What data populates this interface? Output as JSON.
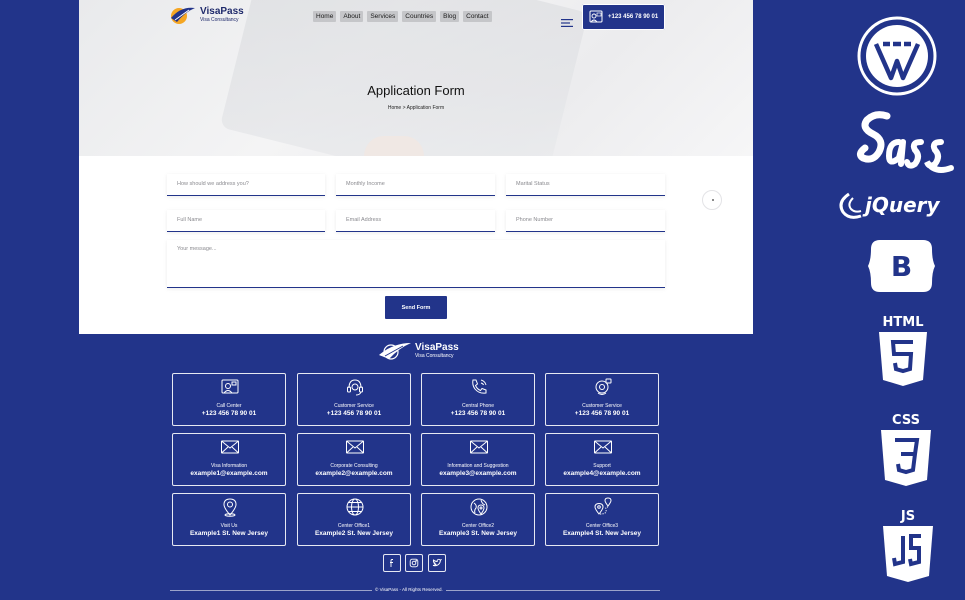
{
  "brand": {
    "name": "VisaPass",
    "tagline": "Visa Consultancy"
  },
  "nav": {
    "items": [
      "Home",
      "About",
      "Services",
      "Countries",
      "Blog",
      "Contact"
    ]
  },
  "header": {
    "phone": "+123 456 78 90 01"
  },
  "hero": {
    "title": "Application Form",
    "breadcrumb": {
      "home": "Home",
      "separator": ">",
      "current": "Application Form"
    }
  },
  "form": {
    "name_placeholder": "How should we address you?",
    "income_placeholder": "Monthly Income",
    "marital_placeholder": "Marital Status",
    "fullname_placeholder": "Full Name",
    "email_placeholder": "Email Address",
    "phone_placeholder": "Phone Number",
    "message_placeholder": "Your message...",
    "submit_label": "Send Form"
  },
  "footer": {
    "cards": [
      {
        "icon": "call-center-icon",
        "label": "Call Center",
        "value": "+123 456 78 90 01"
      },
      {
        "icon": "headset-icon",
        "label": "Customer Service",
        "value": "+123 456 78 90 01"
      },
      {
        "icon": "phone-icon",
        "label": "Central Phone",
        "value": "+123 456 78 90 01"
      },
      {
        "icon": "support-agent-icon",
        "label": "Customer Service",
        "value": "+123 456 78 90 01"
      },
      {
        "icon": "envelope-icon",
        "label": "Visa Information",
        "value": "example1@example.com"
      },
      {
        "icon": "envelope-icon",
        "label": "Corporate Consulting",
        "value": "example2@example.com"
      },
      {
        "icon": "envelope-icon",
        "label": "Information and Suggestion",
        "value": "example3@example.com"
      },
      {
        "icon": "envelope-icon",
        "label": "Support",
        "value": "example4@example.com"
      },
      {
        "icon": "map-pin-icon",
        "label": "Visit Us",
        "value": "Example1 St. New Jersey"
      },
      {
        "icon": "globe-icon",
        "label": "Center Office1",
        "value": "Example2 St. New Jersey"
      },
      {
        "icon": "globe-pin-icon",
        "label": "Center Office2",
        "value": "Example3 St. New Jersey"
      },
      {
        "icon": "map-route-icon",
        "label": "Center Office3",
        "value": "Example4 St. New Jersey"
      }
    ],
    "social": [
      "facebook-icon",
      "instagram-icon",
      "twitter-icon"
    ],
    "copyright": "© VisaPass - All Rights Reserved."
  },
  "tech_badges": [
    "wordpress-logo",
    "sass-logo",
    "jquery-logo",
    "bootstrap-logo",
    "html5-logo",
    "css3-logo",
    "js-logo"
  ],
  "colors": {
    "primary": "#22348a",
    "accent": "#f5a623",
    "white": "#ffffff"
  }
}
